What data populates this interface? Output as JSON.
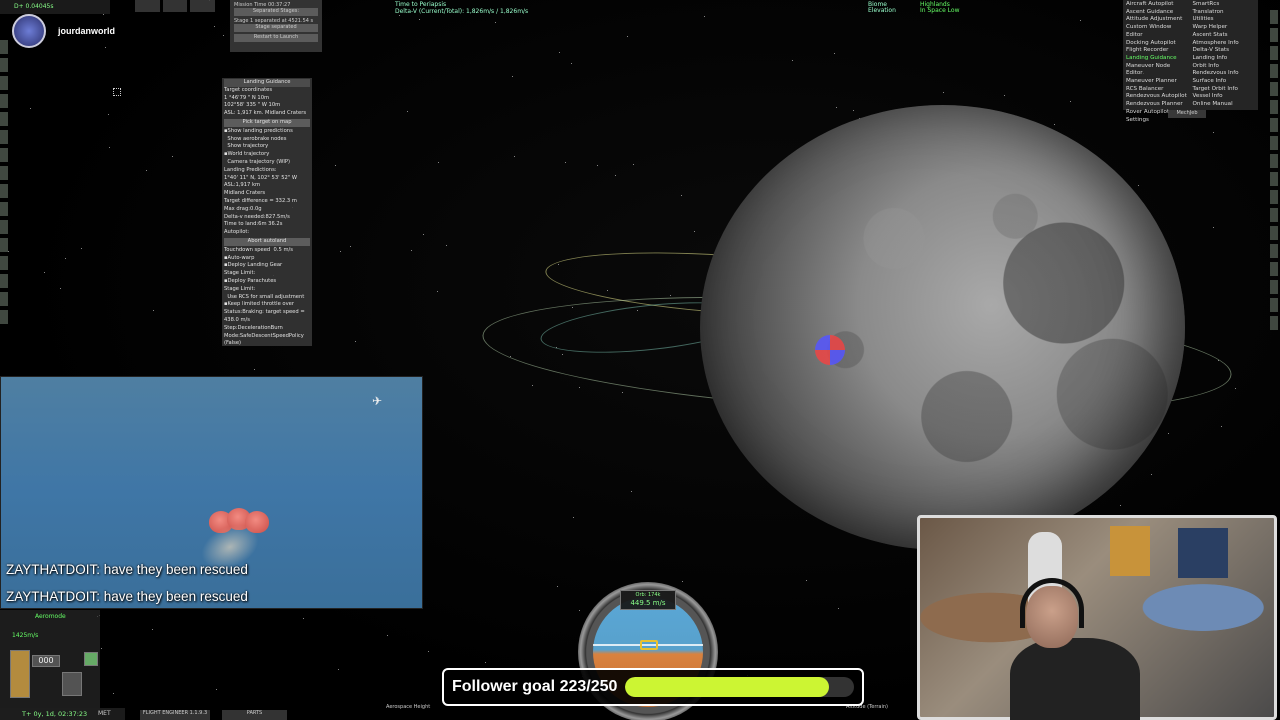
{
  "hud": {
    "delta_time": "D+ 0.04045s",
    "met_time": "T+ 0y, 1d, 02:37:23",
    "met_label": "MET",
    "left_readout": "1425m/s",
    "aeromode_label": "Aeromode",
    "gear_count": "000"
  },
  "streamer": {
    "name": "jourdanworld"
  },
  "staging": {
    "header": "Mission Time 00:37:27",
    "title": "Separated Stages:",
    "row1": "Stage 1 separated at 4521.54 s",
    "row2": "Stage separated",
    "button": "Restart to Launch"
  },
  "top_texts": {
    "time_to_periapsis": "Time to Periapsis",
    "deltav": "Delta-V (Current/Total): 1,826m/s / 1,826m/s",
    "biome": "Biome",
    "elevation": "Elevation",
    "biome_value": "Highlands",
    "elevation_value": "In Space Low"
  },
  "landing": {
    "title": "Landing Guidance",
    "target_coords_label": "Target coordinates",
    "lat": "1  °46'79  \" N",
    "lat_step": "10m",
    "lon": "102°58' 335  \" W",
    "lon_step": "10m",
    "asl": "ASL: 1,917 km. Midland Craters",
    "pick_target": "Pick target on map",
    "opt1": "Show landing predictions",
    "opt2": "Show aerobrake nodes",
    "opt3": "Show trajectory",
    "opt4": "World trajectory",
    "opt5": "Camera trajectory (WIP)",
    "predictions_label": "Landing Predictions:",
    "pred_coords": "1°40' 11\" N, 102° 53' 52\" W",
    "pred_asl": "ASL:1,917 km",
    "pred_biome": "Midland Craters",
    "target_diff": "Target difference = 332.3   m",
    "max_drag": "Max drag:0.0g",
    "deltav_needed": "Delta-v needed:827.5m/s",
    "time_to_land": "Time to land:6m 36.2s",
    "autopilot_label": "Autopilot:",
    "abort_button": "Abort autoland",
    "touchdown_label": "Touchdown speed",
    "touchdown_value": "0.5",
    "touchdown_unit": "m/s",
    "auto_warp": "Auto-warp",
    "deploy_gear": "Deploy Landing Gear",
    "stage_limit1": "Stage Limit:",
    "deploy_chutes": "Deploy Parachutes",
    "stage_limit2": "Stage Limit:",
    "use_rcs": "Use RCS for small adjustment",
    "keep_throttle": "Keep limited throttle over",
    "status": "Status:Braking: target speed =",
    "status_speed": "438.0 m/s",
    "step": "Step:DecelerationBurn",
    "mode": "Mode:SafeDescentSpeedPolicy",
    "mode_state": "(False)"
  },
  "mechjeb": {
    "col1": [
      "Aircraft Autopilot",
      "Ascent Guidance",
      "Attitude Adjustment",
      "Custom Window Editor",
      "Docking Autopilot",
      "Flight Recorder",
      "Landing Guidance",
      "Maneuver Node Editor",
      "Maneuver Planner",
      "RCS Balancer",
      "Rendezvous Autopilot",
      "Rendezvous Planner",
      "Rover Autopilot",
      "Settings"
    ],
    "col2": [
      "SmartRcs",
      "Translatron",
      "Utilities",
      "Warp Helper",
      "Ascent Stats",
      "Atmosphere Info",
      "Delta-V Stats",
      "Landing Info",
      "Orbit Info",
      "Rendezvous Info",
      "Surface Info",
      "Target Orbit Info",
      "Vessel Info",
      "Online Manual"
    ],
    "highlight": "Landing Guidance",
    "tab_label": "MechJeb"
  },
  "chat": [
    {
      "user": "ZAYTHATDOIT",
      "message": ": have they been rescued"
    },
    {
      "user": "ZAYTHATDOIT",
      "message": ": have they been rescued"
    }
  ],
  "navball": {
    "orbit_label": "Orb: 174k",
    "speed": "449.5 m/s"
  },
  "goal": {
    "label": "Follower goal 223/250",
    "current": 223,
    "target": 250,
    "fill_color": "#ccf533"
  },
  "bottom": {
    "tab1": "FLIGHT ENGINEER 1.1.9.3",
    "tab2": "PARTS",
    "info1": "Aerospace Height",
    "info2": "Altitude (Terrain)"
  },
  "colors": {
    "hud_green": "#88ff88",
    "highlight_green": "#66ff66",
    "goal_fill": "#ccf533"
  }
}
